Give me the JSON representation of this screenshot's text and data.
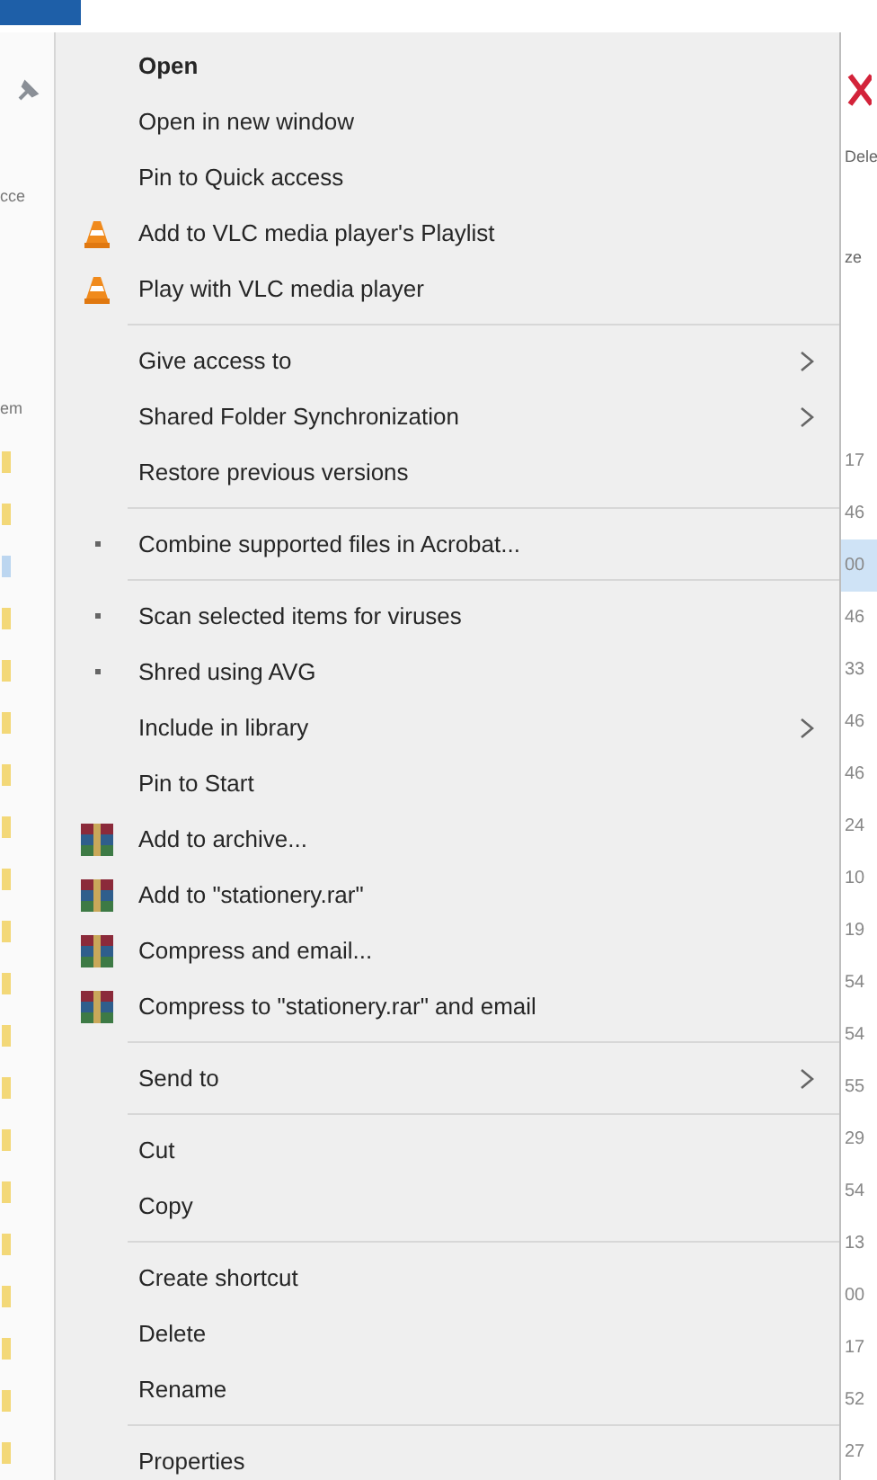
{
  "explorer": {
    "left_texts": [
      "cce",
      "em"
    ],
    "right_top": [
      "Dele",
      "ze"
    ],
    "right_column": [
      "17",
      "46",
      "00",
      "46",
      "33",
      "46",
      "46",
      "24",
      "10",
      "19",
      "54",
      "54",
      "55",
      "29",
      "54",
      "13",
      "00",
      "17",
      "52",
      "27"
    ]
  },
  "context_menu": {
    "items": [
      {
        "kind": "item",
        "label": "Open",
        "bold": true
      },
      {
        "kind": "item",
        "label": "Open in new window"
      },
      {
        "kind": "item",
        "label": "Pin to Quick access"
      },
      {
        "kind": "media",
        "label": "Add to VLC media player's Playlist"
      },
      {
        "kind": "media",
        "label": "Play with VLC media player"
      },
      {
        "kind": "separator"
      },
      {
        "kind": "item",
        "label": "Give access to",
        "submenu": true
      },
      {
        "kind": "item",
        "label": "Shared Folder Synchronization",
        "submenu": true
      },
      {
        "kind": "item",
        "label": "Restore previous versions"
      },
      {
        "kind": "separator"
      },
      {
        "kind": "bullet",
        "label": "Combine supported files in Acrobat..."
      },
      {
        "kind": "separator"
      },
      {
        "kind": "bullet",
        "label": "Scan selected items for viruses"
      },
      {
        "kind": "bullet",
        "label": "Shred using AVG"
      },
      {
        "kind": "item",
        "label": "Include in library",
        "submenu": true
      },
      {
        "kind": "item",
        "label": "Pin to Start"
      },
      {
        "kind": "archive",
        "label": "Add to archive..."
      },
      {
        "kind": "archive",
        "label": "Add to \"stationery.rar\""
      },
      {
        "kind": "archive",
        "label": "Compress and email..."
      },
      {
        "kind": "archive",
        "label": "Compress to \"stationery.rar\" and email"
      },
      {
        "kind": "separator"
      },
      {
        "kind": "item",
        "label": "Send to",
        "submenu": true
      },
      {
        "kind": "separator"
      },
      {
        "kind": "item",
        "label": "Cut"
      },
      {
        "kind": "item",
        "label": "Copy"
      },
      {
        "kind": "separator"
      },
      {
        "kind": "item",
        "label": "Create shortcut"
      },
      {
        "kind": "item",
        "label": "Delete"
      },
      {
        "kind": "item",
        "label": "Rename"
      },
      {
        "kind": "separator"
      },
      {
        "kind": "item",
        "label": "Properties"
      }
    ]
  }
}
